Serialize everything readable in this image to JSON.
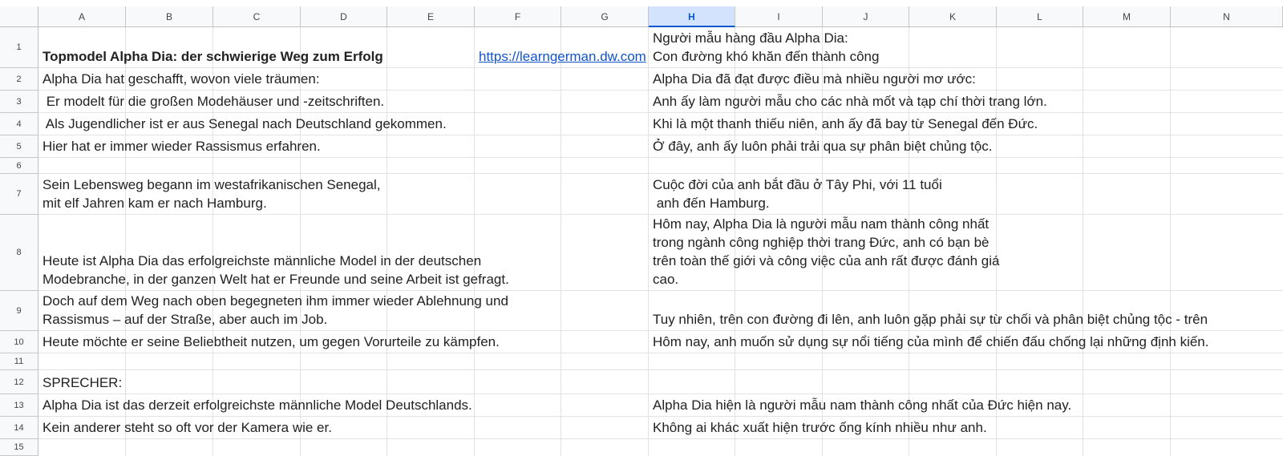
{
  "sheet": {
    "columns": [
      "A",
      "B",
      "C",
      "D",
      "E",
      "F",
      "G",
      "H",
      "I",
      "J",
      "K",
      "L",
      "M",
      "N"
    ],
    "selected_column": "H",
    "rows": [
      "1",
      "2",
      "3",
      "4",
      "5",
      "6",
      "7",
      "8",
      "9",
      "10",
      "11",
      "12",
      "13",
      "14",
      "15"
    ],
    "cells": {
      "A1": "Topmodel Alpha Dia: der schwierige Weg zum Erfolg",
      "F1": "https://learngerman.dw.com",
      "H1": "Người mẫu hàng đầu Alpha Dia:\nCon đường khó khăn đến thành công",
      "A2": "Alpha Dia hat geschafft, wovon viele träumen:",
      "H2": "Alpha Dia đã đạt được điều mà nhiều người mơ ước:",
      "A3": " Er modelt für die großen Modehäuser und -zeitschriften.",
      "H3": "Anh ấy làm người mẫu cho các nhà mốt và tạp chí thời trang lớn.",
      "A4": " Als Jugendlicher ist er aus Senegal nach Deutschland gekommen.",
      "H4": "Khi là một thanh thiếu niên, anh ấy đã bay từ Senegal đến Đức.",
      "A5": "Hier hat er immer wieder Rassismus erfahren.",
      "H5": "Ở đây, anh ấy luôn phải trải qua sự phân biệt chủng tộc.",
      "A7": "Sein Lebensweg begann im westafrikanischen Senegal,\nmit elf Jahren kam er nach Hamburg.",
      "H7": "Cuộc đời của anh bắt đầu ở Tây Phi, với 11 tuổi\n anh đến Hamburg.",
      "A8": "Heute ist Alpha Dia das erfolgreichste männliche Model in der deutschen\nModebranche, in der ganzen Welt hat er Freunde und seine Arbeit ist gefragt.",
      "H8": "Hôm nay, Alpha Dia là người mẫu nam thành công nhất\ntrong ngành công nghiệp thời trang Đức, anh có bạn bè\ntrên toàn thế giới và công việc của anh rất được đánh giá\ncao.",
      "A9": "Doch auf dem Weg nach oben begegneten ihm immer wieder Ablehnung und\nRassismus – auf der Straße, aber auch im Job.",
      "H9": "Tuy nhiên, trên con đường đi lên, anh luôn gặp phải sự từ chối và phân biệt chủng tộc - trên",
      "A10": "Heute möchte er seine Beliebtheit nutzen, um gegen Vorurteile zu kämpfen.",
      "H10": "Hôm nay, anh muốn sử dụng sự nổi tiếng của mình để chiến đấu chống lại những định kiến.",
      "A12": "SPRECHER:",
      "A13": "Alpha Dia ist das derzeit erfolgreichste männliche Model Deutschlands.",
      "H13": "Alpha Dia hiện là người mẫu nam thành công nhất của Đức hiện nay.",
      "A14": "Kein anderer steht so oft vor der Kamera wie er.",
      "H14": "Không ai khác xuất hiện trước ống kính nhiều như anh."
    }
  }
}
